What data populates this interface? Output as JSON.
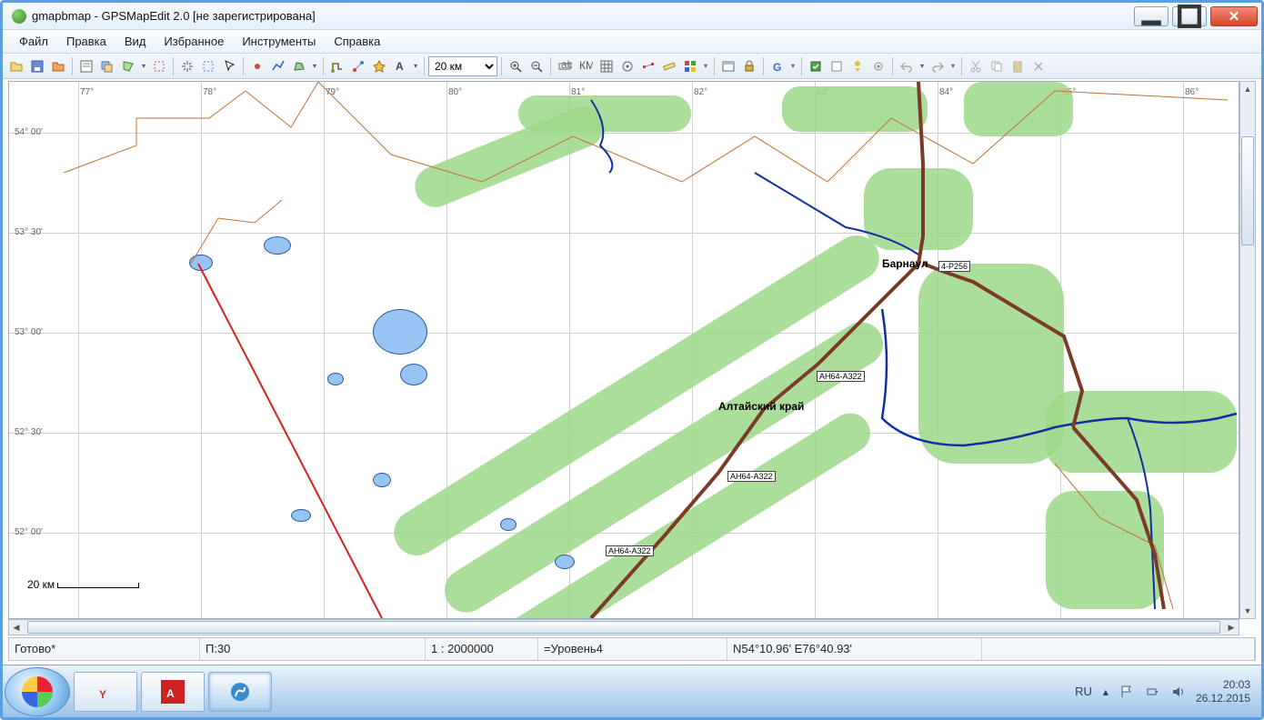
{
  "window": {
    "title": "gmapbmap - GPSMapEdit 2.0 [не зарегистрирована]"
  },
  "menu": {
    "items": [
      "Файл",
      "Правка",
      "Вид",
      "Избранное",
      "Инструменты",
      "Справка"
    ]
  },
  "toolbar": {
    "scale_value": "20 км"
  },
  "map": {
    "lon_labels": [
      "77°",
      "78°",
      "79°",
      "80°",
      "81°",
      "82°",
      "83°",
      "84°",
      "85°",
      "86°"
    ],
    "lat_labels": [
      "54° 00'",
      "53° 30'",
      "53° 00'",
      "52° 30'",
      "52° 00'"
    ],
    "city": "Барнаул",
    "region": "Алтайский край",
    "road_codes": [
      "АН64-А322",
      "АН64-А322",
      "АН64-А322"
    ],
    "road_code_east": "4-Р256",
    "scale_text": "20 км"
  },
  "status": {
    "ready": "Готово*",
    "p": "П:30",
    "ratio": "1 : 2000000",
    "level": "=Уровень4",
    "coords": "N54°10.96' E76°40.93'"
  },
  "taskbar": {
    "lang": "RU",
    "time": "20:03",
    "date": "26.12.2015"
  }
}
